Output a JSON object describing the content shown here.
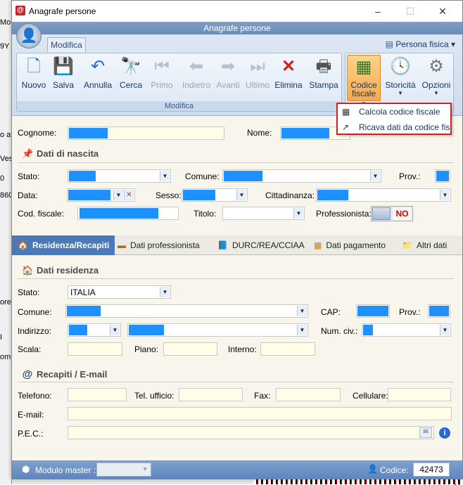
{
  "window": {
    "title": "Anagrafe persone",
    "minimize": "–",
    "maximize": "☐",
    "close": "✕"
  },
  "ribbon": {
    "title": "Anagrafe persone",
    "tab": "Modifica",
    "persona_selector": "Persona fisica",
    "group_modifica": {
      "label": "Modifica",
      "buttons": [
        "Nuovo",
        "Salva",
        "Annulla",
        "Cerca",
        "Primo",
        "Indietro",
        "Avanti",
        "Ultimo",
        "Elimina",
        "Stampa"
      ]
    },
    "codice_fiscale": "Codice fiscale",
    "storicita": "Storicità",
    "opzioni": "Opzioni"
  },
  "menu": {
    "item1": "Calcola codice fiscale",
    "item2": "Ricava dati da codice fisca"
  },
  "form": {
    "cognome_label": "Cognome:",
    "nome_label": "Nome:",
    "section_nascita": "Dati di nascita",
    "stato_label": "Stato:",
    "comune_label": "Comune:",
    "prov_label": "Prov.:",
    "data_label": "Data:",
    "sesso_label": "Sesso:",
    "cittadinanza_label": "Cittadinanza:",
    "codfiscale_label": "Cod. fiscale:",
    "titolo_label": "Titolo:",
    "professionista_label": "Professionista:",
    "professionista_value": "NO"
  },
  "tabs": [
    "Residenza/Recapiti",
    "Dati  professionista",
    "DURC/REA/CCIAA",
    "Dati pagamento",
    "Altri dati"
  ],
  "residenza": {
    "section": "Dati residenza",
    "stato_label": "Stato:",
    "stato_value": "ITALIA",
    "comune_label": "Comune:",
    "cap_label": "CAP:",
    "prov_label": "Prov.:",
    "indirizzo_label": "Indirizzo:",
    "numciv_label": "Num. civ.:",
    "scala_label": "Scala:",
    "piano_label": "Piano:",
    "interno_label": "Interno:"
  },
  "recapiti": {
    "section": "Recapiti / E-mail",
    "telefono_label": "Telefono:",
    "ufficio_label": "Tel. ufficio:",
    "fax_label": "Fax:",
    "cellulare_label": "Cellulare:",
    "email_label": "E-mail:",
    "pec_label": "P.E.C.:"
  },
  "status": {
    "modulo_label": "Modulo master :",
    "codice_label": "Codice:",
    "codice_value": "42473"
  },
  "background": {
    "texts": [
      "Mo",
      "9Y",
      "o att",
      "Vesp",
      "0",
      "860",
      "ore",
      "I",
      "omu"
    ]
  },
  "colors": {
    "accent": "#4b78b6",
    "redacted": "#1e90ff",
    "highlight": "#d02020"
  }
}
